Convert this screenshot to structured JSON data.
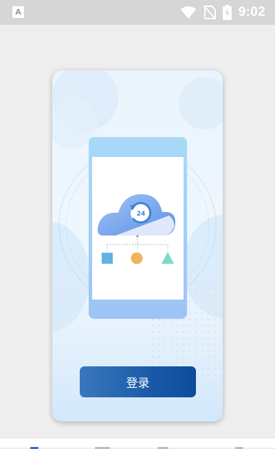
{
  "statusbar": {
    "app_icon_letter": "A",
    "time": "9:02",
    "icons": [
      "wifi-icon",
      "no-sim-icon",
      "battery-charging-icon"
    ]
  },
  "card": {
    "illustration": "phone-cloud-backup-illustration",
    "cloud_badge_text": "24",
    "login_label": "登录"
  },
  "colors": {
    "button_start": "#3a78bd",
    "button_end": "#0c4c99",
    "square": "#5fb3dd",
    "circle": "#f2b35d",
    "triangle": "#7fd8c8"
  },
  "bottom_nav": {
    "icons": [
      "tab-icon-1",
      "tab-icon-2",
      "tab-icon-3",
      "tab-icon-4"
    ]
  }
}
